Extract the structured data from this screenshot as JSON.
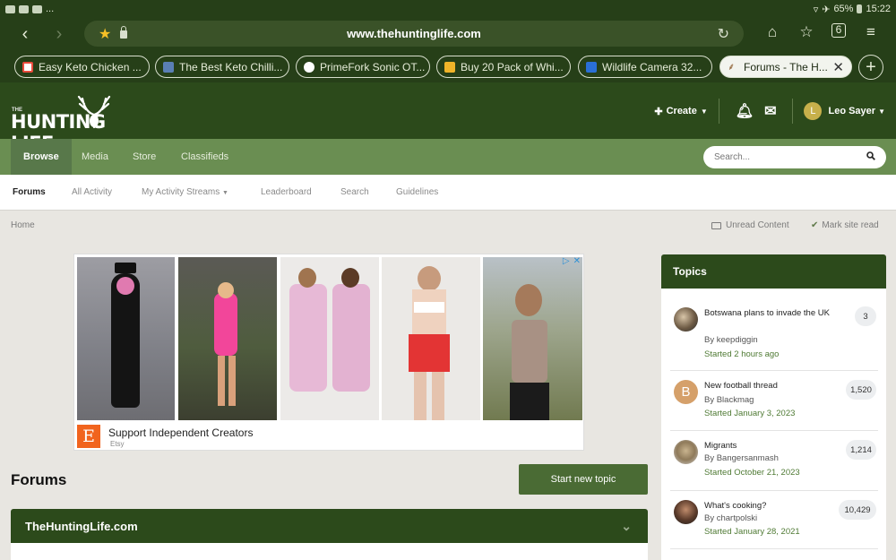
{
  "status_bar": {
    "battery": "65%",
    "time": "15:22",
    "left_icons": [
      "youtube-icon",
      "mail-icon",
      "news-icon"
    ],
    "more": "..."
  },
  "browser": {
    "url": "www.thehuntinglife.com",
    "tabs": [
      {
        "label": "Easy Keto Chicken ...",
        "favicon_color": "#e94b3c"
      },
      {
        "label": "The Best Keto Chilli...",
        "favicon_color": "#5a7fb5"
      },
      {
        "label": "PrimeFork Sonic OT...",
        "favicon_color": "#ffffff"
      },
      {
        "label": "Buy 20 Pack of Whi...",
        "favicon_color": "#f0b429"
      },
      {
        "label": "Wildlife Camera 32...",
        "favicon_color": "#2a6fd6"
      },
      {
        "label": "Forums - The H...",
        "favicon_color": "#8b5a2b",
        "active": true
      }
    ]
  },
  "site": {
    "logo_small": "THE",
    "logo_text": "HUNTING LIFE",
    "create_label": "Create",
    "user_initial": "L",
    "user_name": "Leo Sayer",
    "main_nav": [
      "Browse",
      "Media",
      "Store",
      "Classifieds"
    ],
    "search_placeholder": "Search...",
    "sub_nav": [
      "Forums",
      "All Activity",
      "My Activity Streams",
      "Leaderboard",
      "Search",
      "Guidelines"
    ],
    "breadcrumb": "Home",
    "unread_label": "Unread Content",
    "markread_label": "Mark site read"
  },
  "ad": {
    "title": "Support Independent Creators",
    "source": "Etsy",
    "logo_letter": "E"
  },
  "forums": {
    "title": "Forums",
    "start_button": "Start new topic",
    "category": "TheHuntingLife.com"
  },
  "topics": {
    "heading": "Topics",
    "items": [
      {
        "title": "Botswana plans to invade the UK",
        "author": "By keepdiggin",
        "started": "Started 2 hours ago",
        "count": "3"
      },
      {
        "title": "New football thread",
        "author": "By Blackmag",
        "started": "Started January 3, 2023",
        "count": "1,520",
        "avatar_letter": "B"
      },
      {
        "title": "Migrants",
        "author": "By Bangersanmash",
        "started": "Started October 21, 2023",
        "count": "1,214"
      },
      {
        "title": "What's cooking?",
        "author": "By chartpolski",
        "started": "Started January 28, 2021",
        "count": "10,429"
      }
    ]
  }
}
